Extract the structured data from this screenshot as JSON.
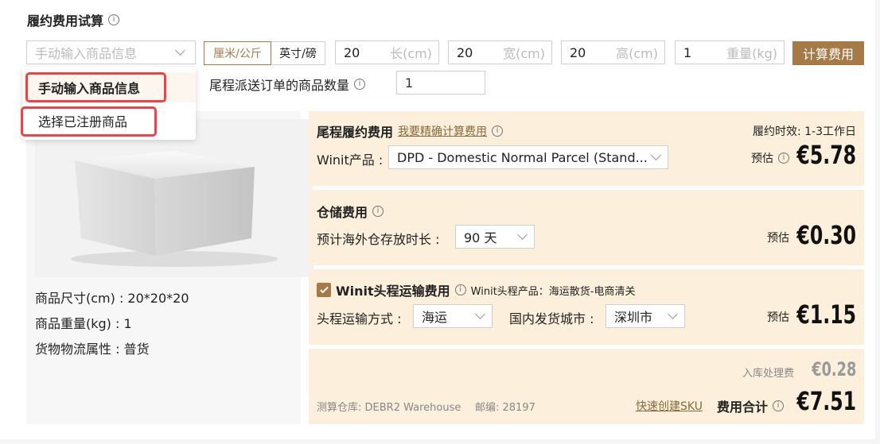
{
  "header": {
    "title": "履约费用试算"
  },
  "goods_select": {
    "placeholder": "手动输入商品信息"
  },
  "unit_toggle": {
    "metric": "厘米/公斤",
    "imperial": "英寸/磅"
  },
  "dims": [
    {
      "value": "20",
      "unit": "长(cm)"
    },
    {
      "value": "20",
      "unit": "宽(cm)"
    },
    {
      "value": "20",
      "unit": "高(cm)"
    },
    {
      "value": "1",
      "unit": "重量(kg)"
    }
  ],
  "calc_button": "计算费用",
  "dropdown": {
    "options": [
      "手动输入商品信息",
      "选择已注册商品"
    ]
  },
  "qty": {
    "label": "尾程派送订单的商品数量",
    "value": "1"
  },
  "product": {
    "size": "商品尺寸(cm) : 20*20*20",
    "weight": "商品重量(kg) : 1",
    "attr": "货物物流属性 : 普货"
  },
  "lastmile": {
    "title": "尾程履约费用",
    "link": "我要精确计算费用",
    "timing": "履约时效: 1-3工作日",
    "product_label": "Winit产品 :",
    "product_value": "DPD - Domestic Normal Parcel (Stand...",
    "est_label": "预估",
    "price": "€5.78"
  },
  "storage": {
    "title": "仓储费用",
    "duration_label": "预计海外仓存放时长 :",
    "duration_value": "90 天",
    "est_label": "预估",
    "price": "€0.30"
  },
  "firstleg": {
    "checked": true,
    "title": "Winit头程运输费用",
    "note": "Winit头程产品：海运散货-电商清关",
    "mode_label": "头程运输方式 :",
    "mode_value": "海运",
    "city_label": "国内发货城市 :",
    "city_value": "深圳市",
    "est_label": "预估",
    "price": "€1.15"
  },
  "summary": {
    "inbound_label": "入库处理费",
    "inbound_price": "€0.28",
    "warehouse": "测算仓库: DEBR2 Warehouse",
    "zip": "邮编: 28197",
    "sku_link": "快速创建SKU",
    "total_label": "费用合计",
    "total_price": "€7.51"
  },
  "colors": {
    "accent": "#a57a47",
    "panel": "#fcefdc",
    "highlight": "#e64646"
  }
}
